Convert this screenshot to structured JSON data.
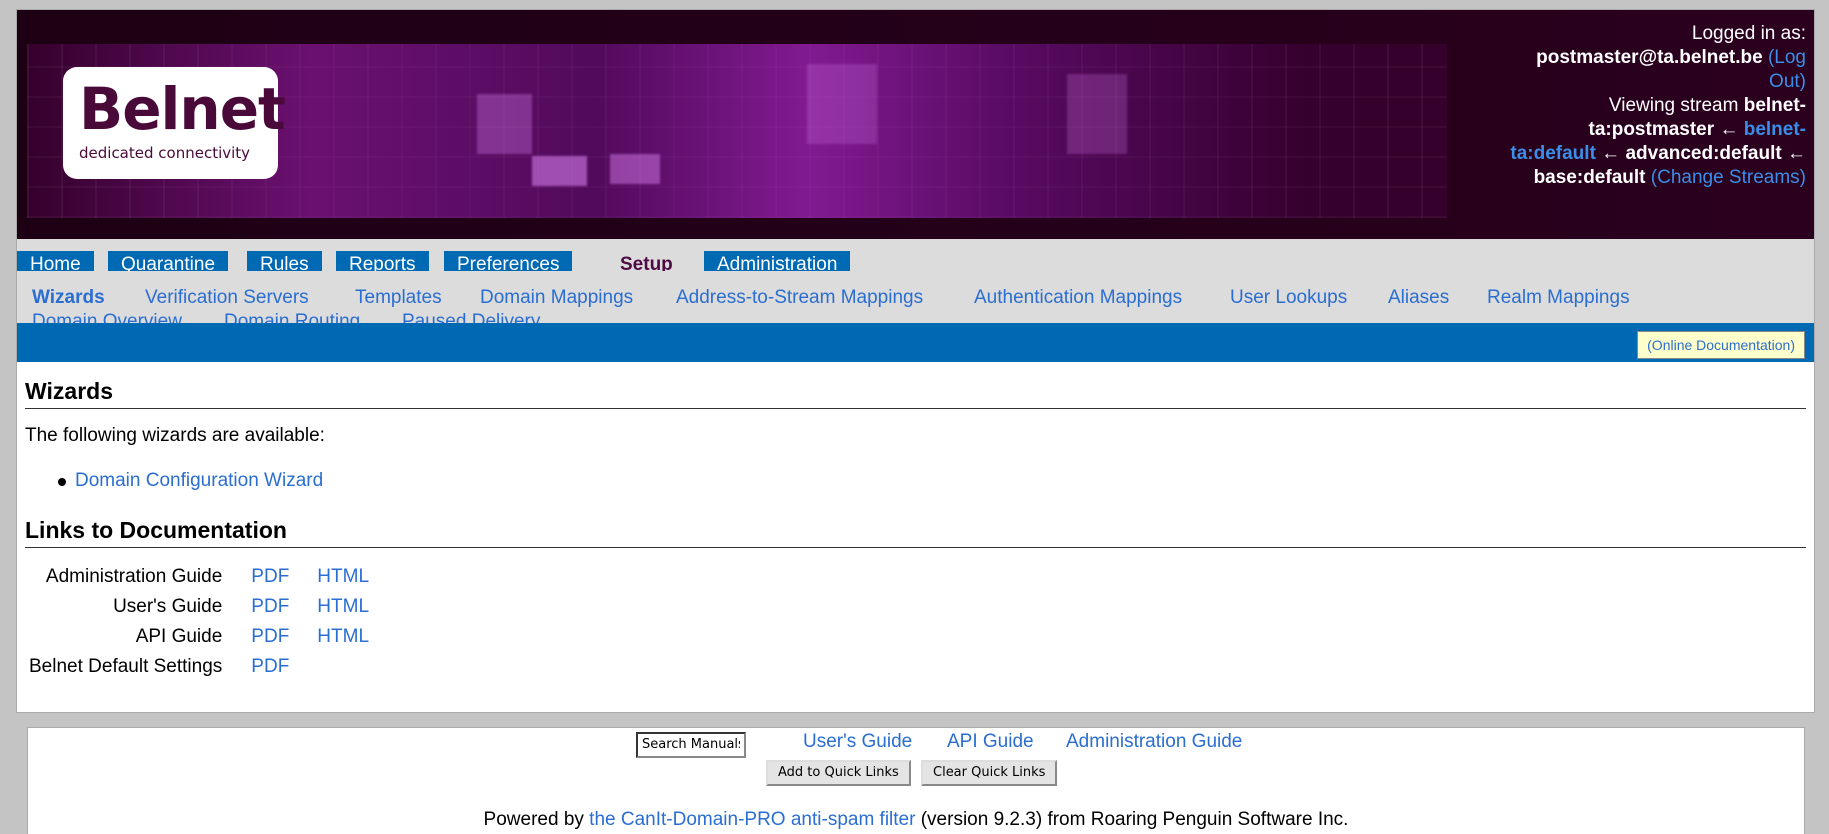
{
  "header": {
    "logo_word": "Belnet",
    "logo_tagline": "dedicated connectivity",
    "login_prefix": "Logged in as:",
    "username": "postmaster@ta.belnet.be",
    "logout_label": "(Log Out)",
    "viewing_prefix": "Viewing stream",
    "stream_current": "belnet-ta:postmaster",
    "arrow": "←",
    "stream_link": "belnet-ta:default",
    "stream_advanced": "advanced:default",
    "stream_base": "base:default",
    "change_streams_label": "(Change Streams)"
  },
  "tabs": [
    {
      "label": "Home"
    },
    {
      "label": "Quarantine"
    },
    {
      "label": "Rules"
    },
    {
      "label": "Reports"
    },
    {
      "label": "Preferences"
    },
    {
      "label": "Setup",
      "active": true
    },
    {
      "label": "Administration"
    }
  ],
  "subnav": [
    {
      "label": "Wizards",
      "active": true
    },
    {
      "label": "Verification Servers"
    },
    {
      "label": "Templates"
    },
    {
      "label": "Domain Mappings"
    },
    {
      "label": "Address-to-Stream Mappings"
    },
    {
      "label": "Authentication Mappings"
    },
    {
      "label": "User Lookups"
    },
    {
      "label": "Aliases"
    },
    {
      "label": "Realm Mappings"
    },
    {
      "label": "Domain Overview"
    },
    {
      "label": "Domain Routing"
    },
    {
      "label": "Paused Delivery"
    }
  ],
  "online_docs_label": "(Online Documentation)",
  "wizards": {
    "heading": "Wizards",
    "intro": "The following wizards are available:",
    "items": [
      "Domain Configuration Wizard"
    ]
  },
  "docs": {
    "heading": "Links to Documentation",
    "rows": [
      {
        "label": "Administration Guide",
        "pdf": "PDF",
        "html": "HTML"
      },
      {
        "label": "User's Guide",
        "pdf": "PDF",
        "html": "HTML"
      },
      {
        "label": "API Guide",
        "pdf": "PDF",
        "html": "HTML"
      },
      {
        "label": "Belnet Default Settings",
        "pdf": "PDF"
      }
    ]
  },
  "footer": {
    "search_value": "Search Manuals",
    "links": [
      "User's Guide",
      "API Guide",
      "Administration Guide"
    ],
    "add_quick_links": "Add to Quick Links",
    "clear_quick_links": "Clear Quick Links",
    "powered_prefix": "Powered by",
    "powered_link": "the CanIt-Domain-PRO anti-spam filter",
    "powered_suffix": "(version 9.2.3) from Roaring Penguin Software Inc."
  },
  "colors": {
    "tab_blue": "#0069b4",
    "link_blue": "#2a6ed1",
    "brand_purple": "#4a0a39",
    "docs_note_bg": "#ffffcc"
  }
}
